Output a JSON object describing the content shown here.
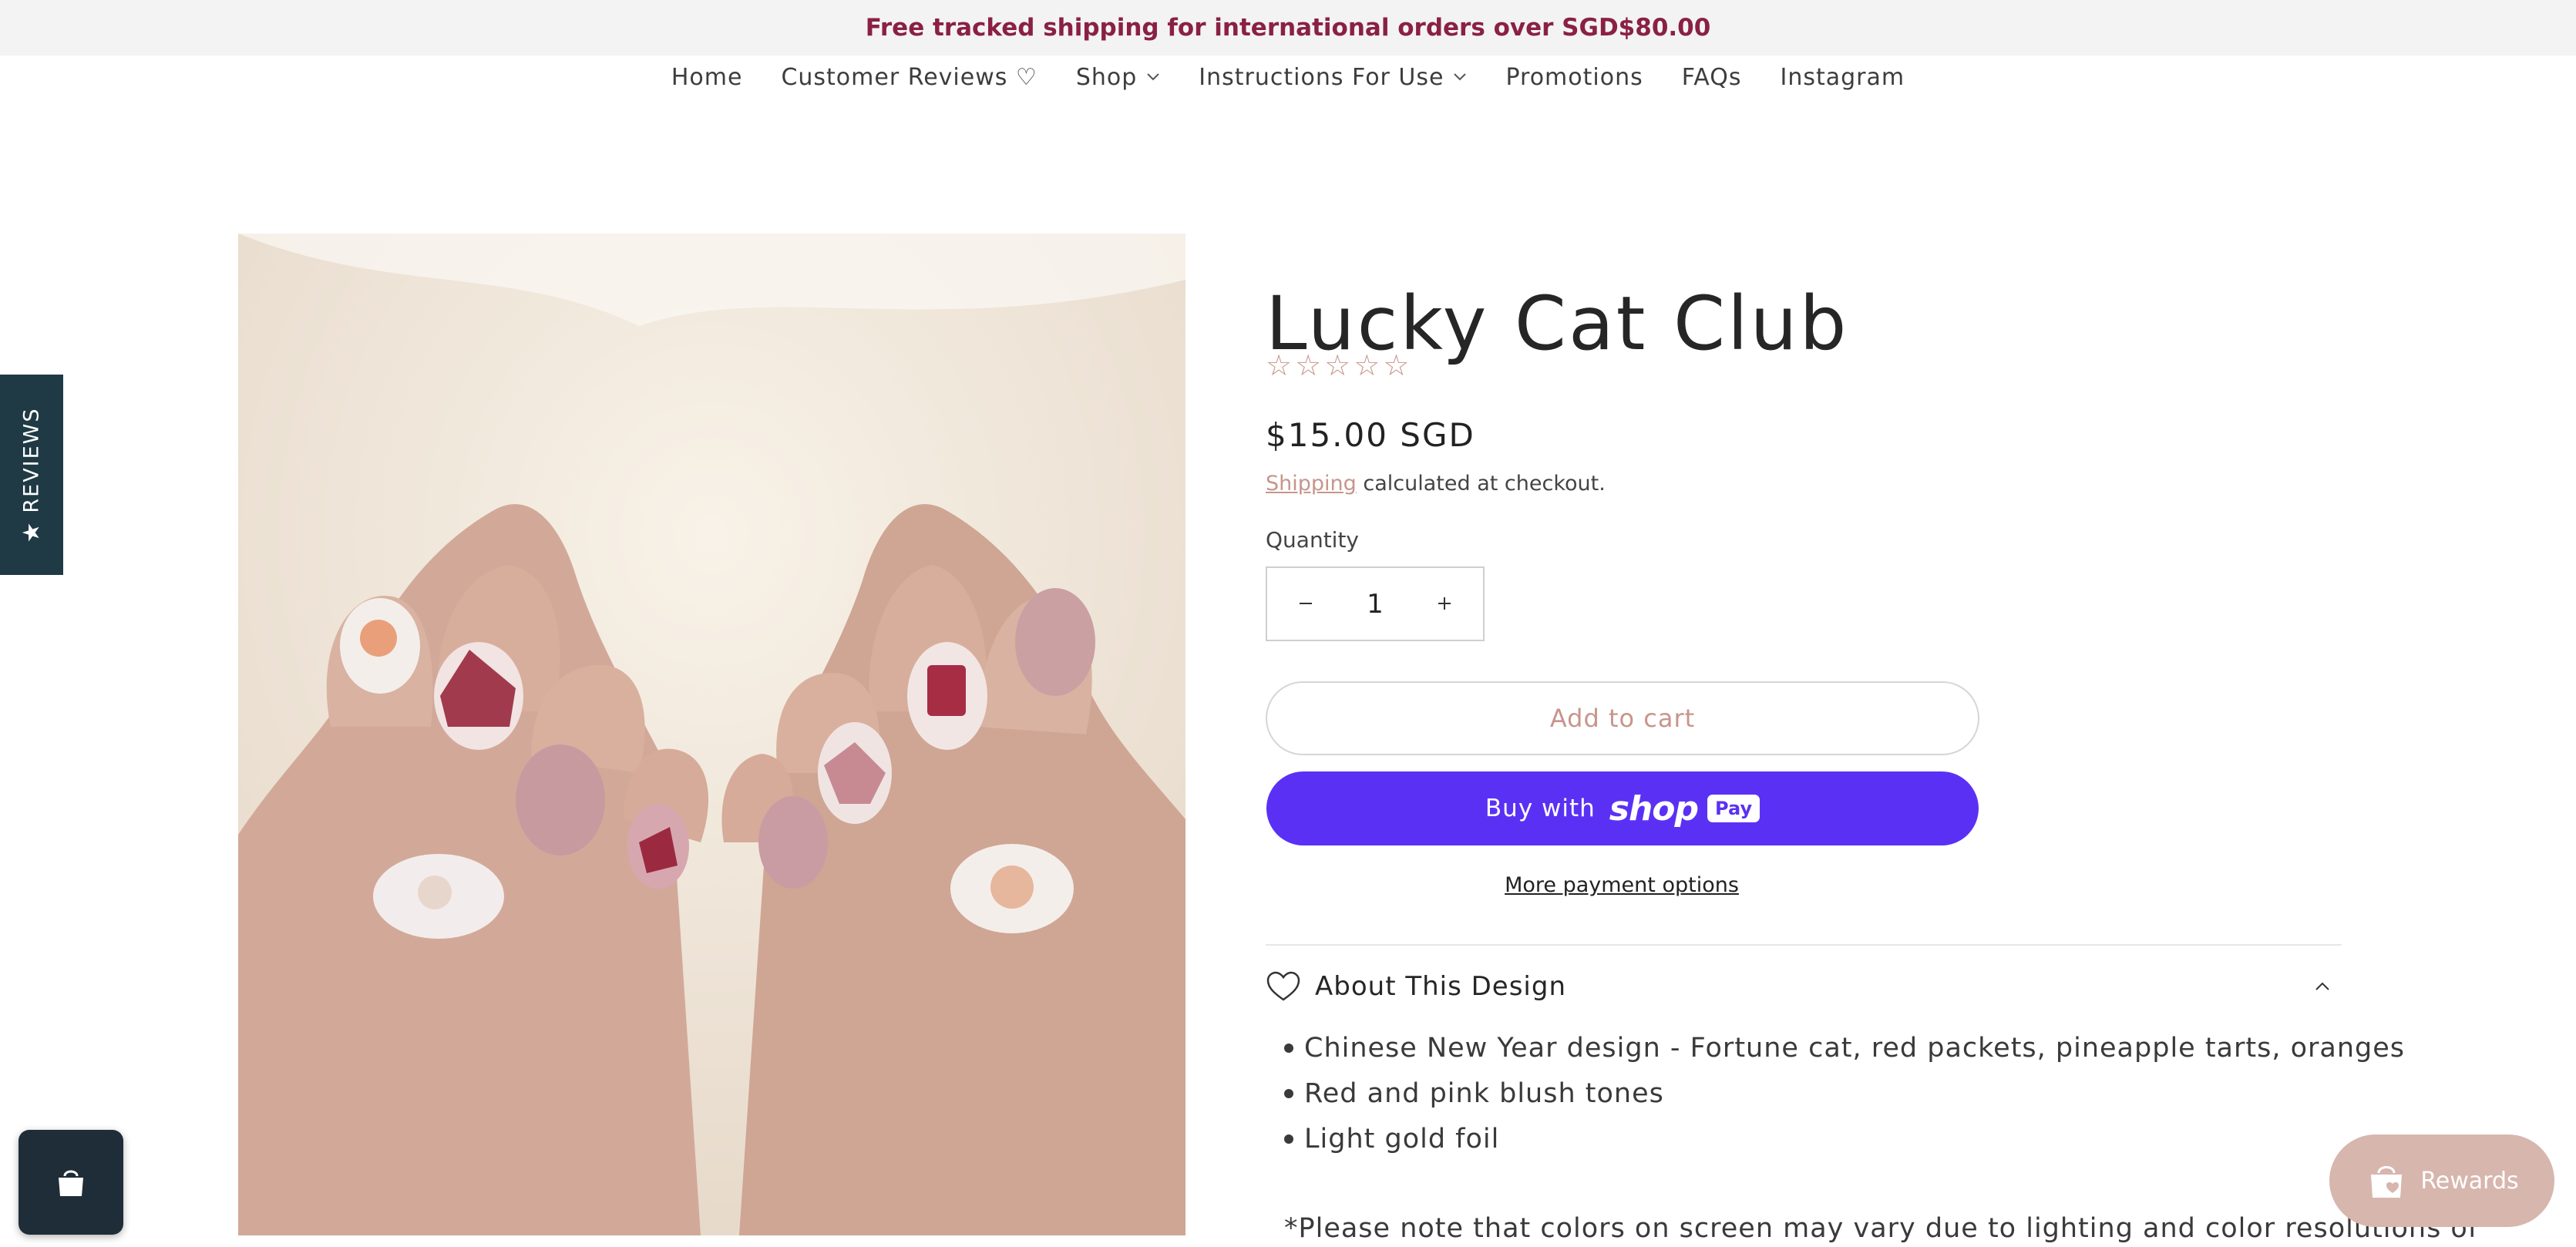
{
  "announcement": "Free tracked shipping for international orders over SGD$80.00",
  "nav": [
    {
      "label": "Home"
    },
    {
      "label": "Customer Reviews ♡"
    },
    {
      "label": "Shop"
    },
    {
      "label": "Instructions For Use"
    },
    {
      "label": "Promotions"
    },
    {
      "label": "FAQs"
    },
    {
      "label": "Instagram"
    }
  ],
  "reviews_tab": {
    "label": "REVIEWS",
    "icon": "star-icon"
  },
  "product": {
    "title": "Lucky Cat Club",
    "rating": 0,
    "rating_max": 5,
    "price": "$15.00 SGD",
    "shipping_link": "Shipping",
    "shipping_suffix": " calculated at checkout.",
    "quantity_label": "Quantity",
    "quantity": "1",
    "add_to_cart": "Add to cart",
    "buy_with": "Buy with",
    "shop_logo": "shop",
    "pay_badge": "Pay",
    "more_payment": "More payment options"
  },
  "about": {
    "label": "About This Design",
    "bullets": [
      "Chinese New Year design - Fortune cat, red packets, pineapple tarts, oranges",
      "Red and pink blush tones",
      "Light gold foil"
    ],
    "note": "*Please note that colors on screen may vary due to lighting and color resolutions of"
  },
  "rewards": {
    "label": "Rewards"
  },
  "colors": {
    "announcement_text": "#8a2045",
    "accent": "#c7958c",
    "shop_pay": "#5a31f4",
    "reviews_tab": "#1f3a45",
    "rewards": "#d7b6ae"
  }
}
